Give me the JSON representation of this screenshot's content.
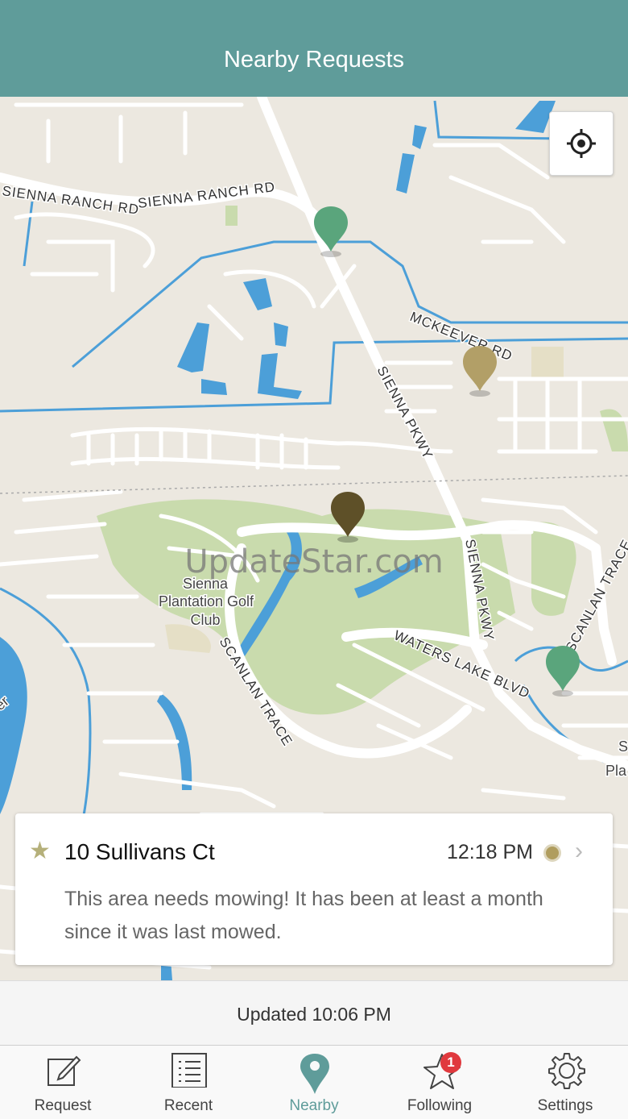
{
  "header": {
    "title": "Nearby Requests"
  },
  "map": {
    "road_labels": [
      "SIENNA RANCH RD",
      "SIENNA RANCH RD",
      "MCKEEVER RD",
      "SIENNA PKWY",
      "SIENNA PKWY",
      "SCANLAN TRACE",
      "SCANLAN TRACE",
      "WATERS LAKE BLVD"
    ],
    "place_labels": [
      "Sienna",
      "Plantation Golf",
      "Club"
    ],
    "edge_labels": [
      "er",
      "S",
      "Pla"
    ],
    "watermark": "UpdateStar.com",
    "locate_button_icon": "crosshair-icon",
    "pin_colors": {
      "green": "#5aa57c",
      "tan": "#b29f67",
      "dark": "#5e5028"
    }
  },
  "card": {
    "star": "★",
    "address": "10 Sullivans Ct",
    "time": "12:18 PM",
    "chevron": "›",
    "description": "This area needs mowing! It has been at least a month since it was last mowed."
  },
  "status": {
    "updated": "Updated 10:06 PM"
  },
  "tabs": [
    {
      "label": "Request",
      "icon": "pencil-square-icon"
    },
    {
      "label": "Recent",
      "icon": "list-icon"
    },
    {
      "label": "Nearby",
      "icon": "map-pin-icon",
      "active": true
    },
    {
      "label": "Following",
      "icon": "star-icon",
      "badge": "1"
    },
    {
      "label": "Settings",
      "icon": "gear-icon"
    }
  ],
  "colors": {
    "accent": "#5f9c9a",
    "badge": "#e0393e"
  }
}
